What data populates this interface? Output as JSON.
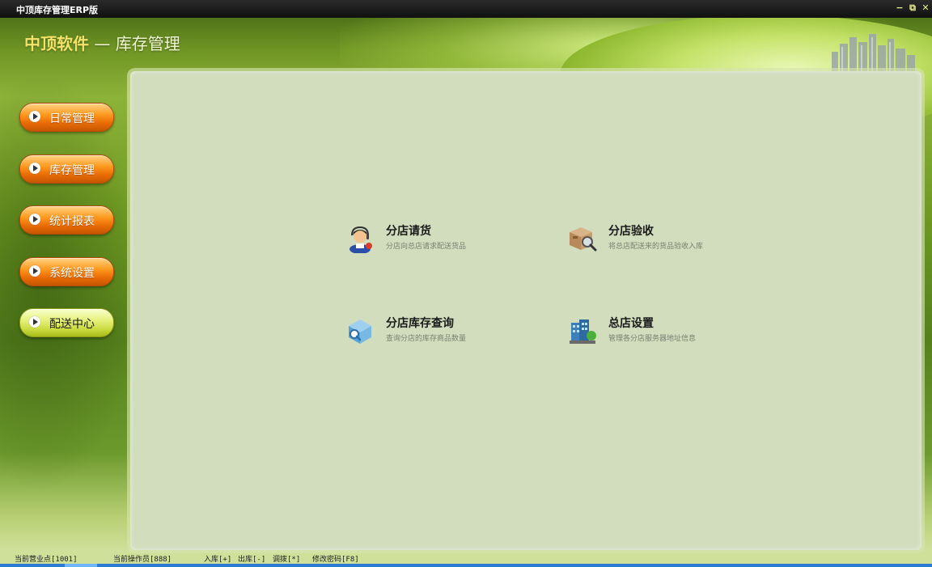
{
  "window": {
    "title": "中顶库存管理ERP版",
    "controls": {
      "minimize": "−",
      "restore": "⧉",
      "close": "✕"
    }
  },
  "brand": {
    "name": "中顶软件",
    "separator": "—",
    "module": "库存管理"
  },
  "nav": {
    "items": [
      {
        "label": "日常管理",
        "style": "orange"
      },
      {
        "label": "库存管理",
        "style": "orange"
      },
      {
        "label": "统计报表",
        "style": "orange"
      },
      {
        "label": "系统设置",
        "style": "orange"
      },
      {
        "label": "配送中心",
        "style": "green"
      }
    ]
  },
  "features": [
    {
      "title": "分店请货",
      "desc": "分店向总店请求配送货品",
      "icon": "operator-icon"
    },
    {
      "title": "分店验收",
      "desc": "将总店配送来的货品验收入库",
      "icon": "box-inspect-icon"
    },
    {
      "title": "分店库存查询",
      "desc": "查询分店的库存商品数量",
      "icon": "package-search-icon"
    },
    {
      "title": "总店设置",
      "desc": "管理各分店服务器地址信息",
      "icon": "building-icon"
    }
  ],
  "status": {
    "store": "当前营业点[1001]",
    "operator": "当前操作员[888]",
    "in": "入库[+]",
    "out": "出库[-]",
    "transfer": "调拨[*]",
    "password": "修改密码[F8]"
  },
  "colors": {
    "accent_orange": "#ff9a1f",
    "accent_green": "#c8d93d",
    "panel": "#d2ddbe"
  }
}
